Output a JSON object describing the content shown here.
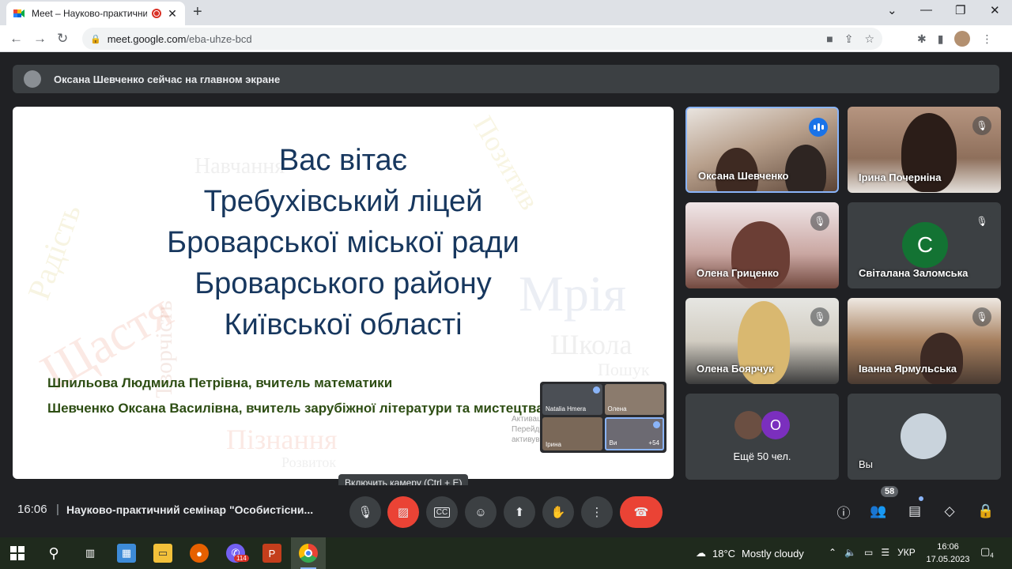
{
  "browser": {
    "tab_title": "Meet – Науково-практичний",
    "tab_close": "✕",
    "new_tab": "+",
    "url_host": "meet.google.com",
    "url_path": "/eba-uhze-bcd"
  },
  "banner": {
    "text": "Оксана Шевченко сейчас на главном экране"
  },
  "slide": {
    "title_lines": [
      "Вас вітає",
      "Требухівський ліцей",
      "Броварської міської ради",
      "Броварського району",
      "Київської області"
    ],
    "authors": [
      "Шпильова Людмила Петрівна, вчитель математики",
      "Шевченко Оксана Василівна, вчитель зарубіжної літератури та мистецтва"
    ],
    "word_cloud": [
      "Щастя",
      "Мрія",
      "Пізнання",
      "Школа",
      "Творчість",
      "Пошук",
      "Радість",
      "Розвиток",
      "Позитив",
      "Навчання"
    ],
    "mini_tiles": [
      "Natalia Hmera",
      "Олена",
      "Ірина",
      "Ви",
      "+54"
    ],
    "activate_windows": [
      "Активація Windows",
      "Перейдіть до розділу \"Параметри\", щоб",
      "активувати Windows."
    ]
  },
  "participants": [
    {
      "name": "Оксана Шевченко",
      "state": "speaking"
    },
    {
      "name": "Ірина Почерніна",
      "state": "muted"
    },
    {
      "name": "Олена Гриценко",
      "state": "muted"
    },
    {
      "name": "Світалана Заломська",
      "state": "muted",
      "initial": "С"
    },
    {
      "name": "Олена Боярчук",
      "state": "muted"
    },
    {
      "name": "Іванна Ярмульська",
      "state": "muted"
    },
    {
      "name": "Ещё 50 чел.",
      "initial": "О"
    },
    {
      "name": "Вы"
    }
  ],
  "meeting": {
    "time": "16:06",
    "separator": "|",
    "name": "Науково-практичний семінар \"Особистісни...",
    "tooltip": "Включить камеру (Ctrl + E)",
    "participant_count": "58"
  },
  "taskbar": {
    "temperature": "18°C",
    "weather": "Mostly cloudy",
    "lang": "УКР",
    "time": "16:06",
    "date": "17.05.2023",
    "viber_badge": "114",
    "notifications": "4"
  },
  "colors": {
    "meet_red": "#ea4335",
    "meet_blue": "#8ab4f8",
    "slide_title": "#17375e",
    "author_text": "#2d4d13"
  }
}
